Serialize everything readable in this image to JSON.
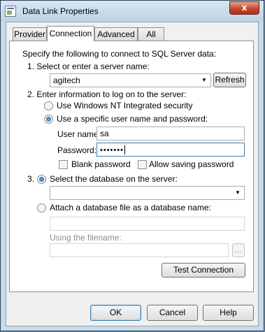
{
  "window": {
    "title": "Data Link Properties",
    "close_glyph": "x"
  },
  "tabs": [
    {
      "label": "Provider"
    },
    {
      "label": "Connection",
      "active": true
    },
    {
      "label": "Advanced"
    },
    {
      "label": "All"
    }
  ],
  "connection": {
    "intro": "Specify the following to connect to SQL Server data:",
    "step1": {
      "label": "1. Select or enter a server name:",
      "server_value": "agitech",
      "refresh_label": "Refresh"
    },
    "step2": {
      "label": "2. Enter information to log on to the server:",
      "option_windows": "Use Windows NT Integrated security",
      "option_specific": "Use a specific user name and password:",
      "selected": "specific",
      "username_label": "User name:",
      "username_value": "sa",
      "password_label": "Password:",
      "password_value": "•••••••",
      "blank_password_label": "Blank password",
      "blank_password_checked": false,
      "allow_saving_label": "Allow saving password",
      "allow_saving_checked": false
    },
    "step3": {
      "number": "3.",
      "option_select_db": "Select the database on the server:",
      "database_value": "",
      "option_attach": "Attach a database file as a database name:",
      "attach_name_value": "",
      "filename_label": "Using the filename:",
      "filename_value": "",
      "browse_label": "...",
      "selected": "select_db"
    },
    "test_button_label": "Test Connection"
  },
  "footer": {
    "ok_label": "OK",
    "cancel_label": "Cancel",
    "help_label": "Help"
  },
  "icons": {
    "dropdown": "▼"
  }
}
